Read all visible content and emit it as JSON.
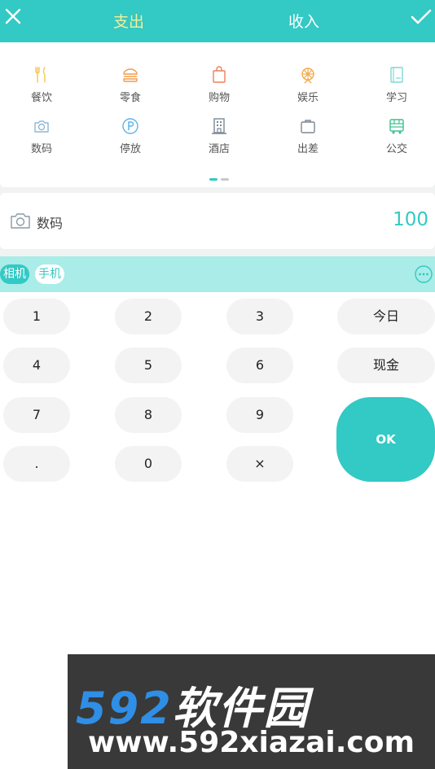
{
  "header": {
    "tab_expense": "支出",
    "tab_income": "收入",
    "active_tab": "expense",
    "accent_color": "#33c9c4",
    "active_tab_color": "#f4ef9a",
    "close_icon": "close-icon",
    "confirm_icon": "check-icon"
  },
  "categories": [
    {
      "label": "餐饮",
      "icon": "fork-knife-icon",
      "color": "#f5c84c"
    },
    {
      "label": "零食",
      "icon": "burger-icon",
      "color": "#f29a4a"
    },
    {
      "label": "购物",
      "icon": "shopping-bag-icon",
      "color": "#f07e5b"
    },
    {
      "label": "娱乐",
      "icon": "ferris-wheel-icon",
      "color": "#f2a94c"
    },
    {
      "label": "学习",
      "icon": "book-icon",
      "color": "#7fd9d4"
    },
    {
      "label": "数码",
      "icon": "camera-icon",
      "color": "#8fb7d6"
    },
    {
      "label": "停放",
      "icon": "parking-icon",
      "color": "#5fb3e8"
    },
    {
      "label": "酒店",
      "icon": "hotel-icon",
      "color": "#7b8794"
    },
    {
      "label": "出差",
      "icon": "suitcase-icon",
      "color": "#7b8794"
    },
    {
      "label": "公交",
      "icon": "bus-icon",
      "color": "#3fbf8f"
    }
  ],
  "pager": {
    "pages": 2,
    "current": 1
  },
  "amount": {
    "category": "数码",
    "icon": "camera-icon",
    "value": "100"
  },
  "tags": [
    "相机",
    "手机"
  ],
  "tags_more_icon": "more-icon",
  "keypad": {
    "keys": [
      "1",
      "2",
      "3",
      "4",
      "5",
      "6",
      "7",
      "8",
      "9",
      ".",
      "0",
      "×"
    ],
    "date_label": "今日",
    "account_label": "现金",
    "ok_label": "OK"
  },
  "watermark": {
    "logo_num": "592",
    "logo_cn": "软件园",
    "url": "www.592xiazai.com"
  }
}
